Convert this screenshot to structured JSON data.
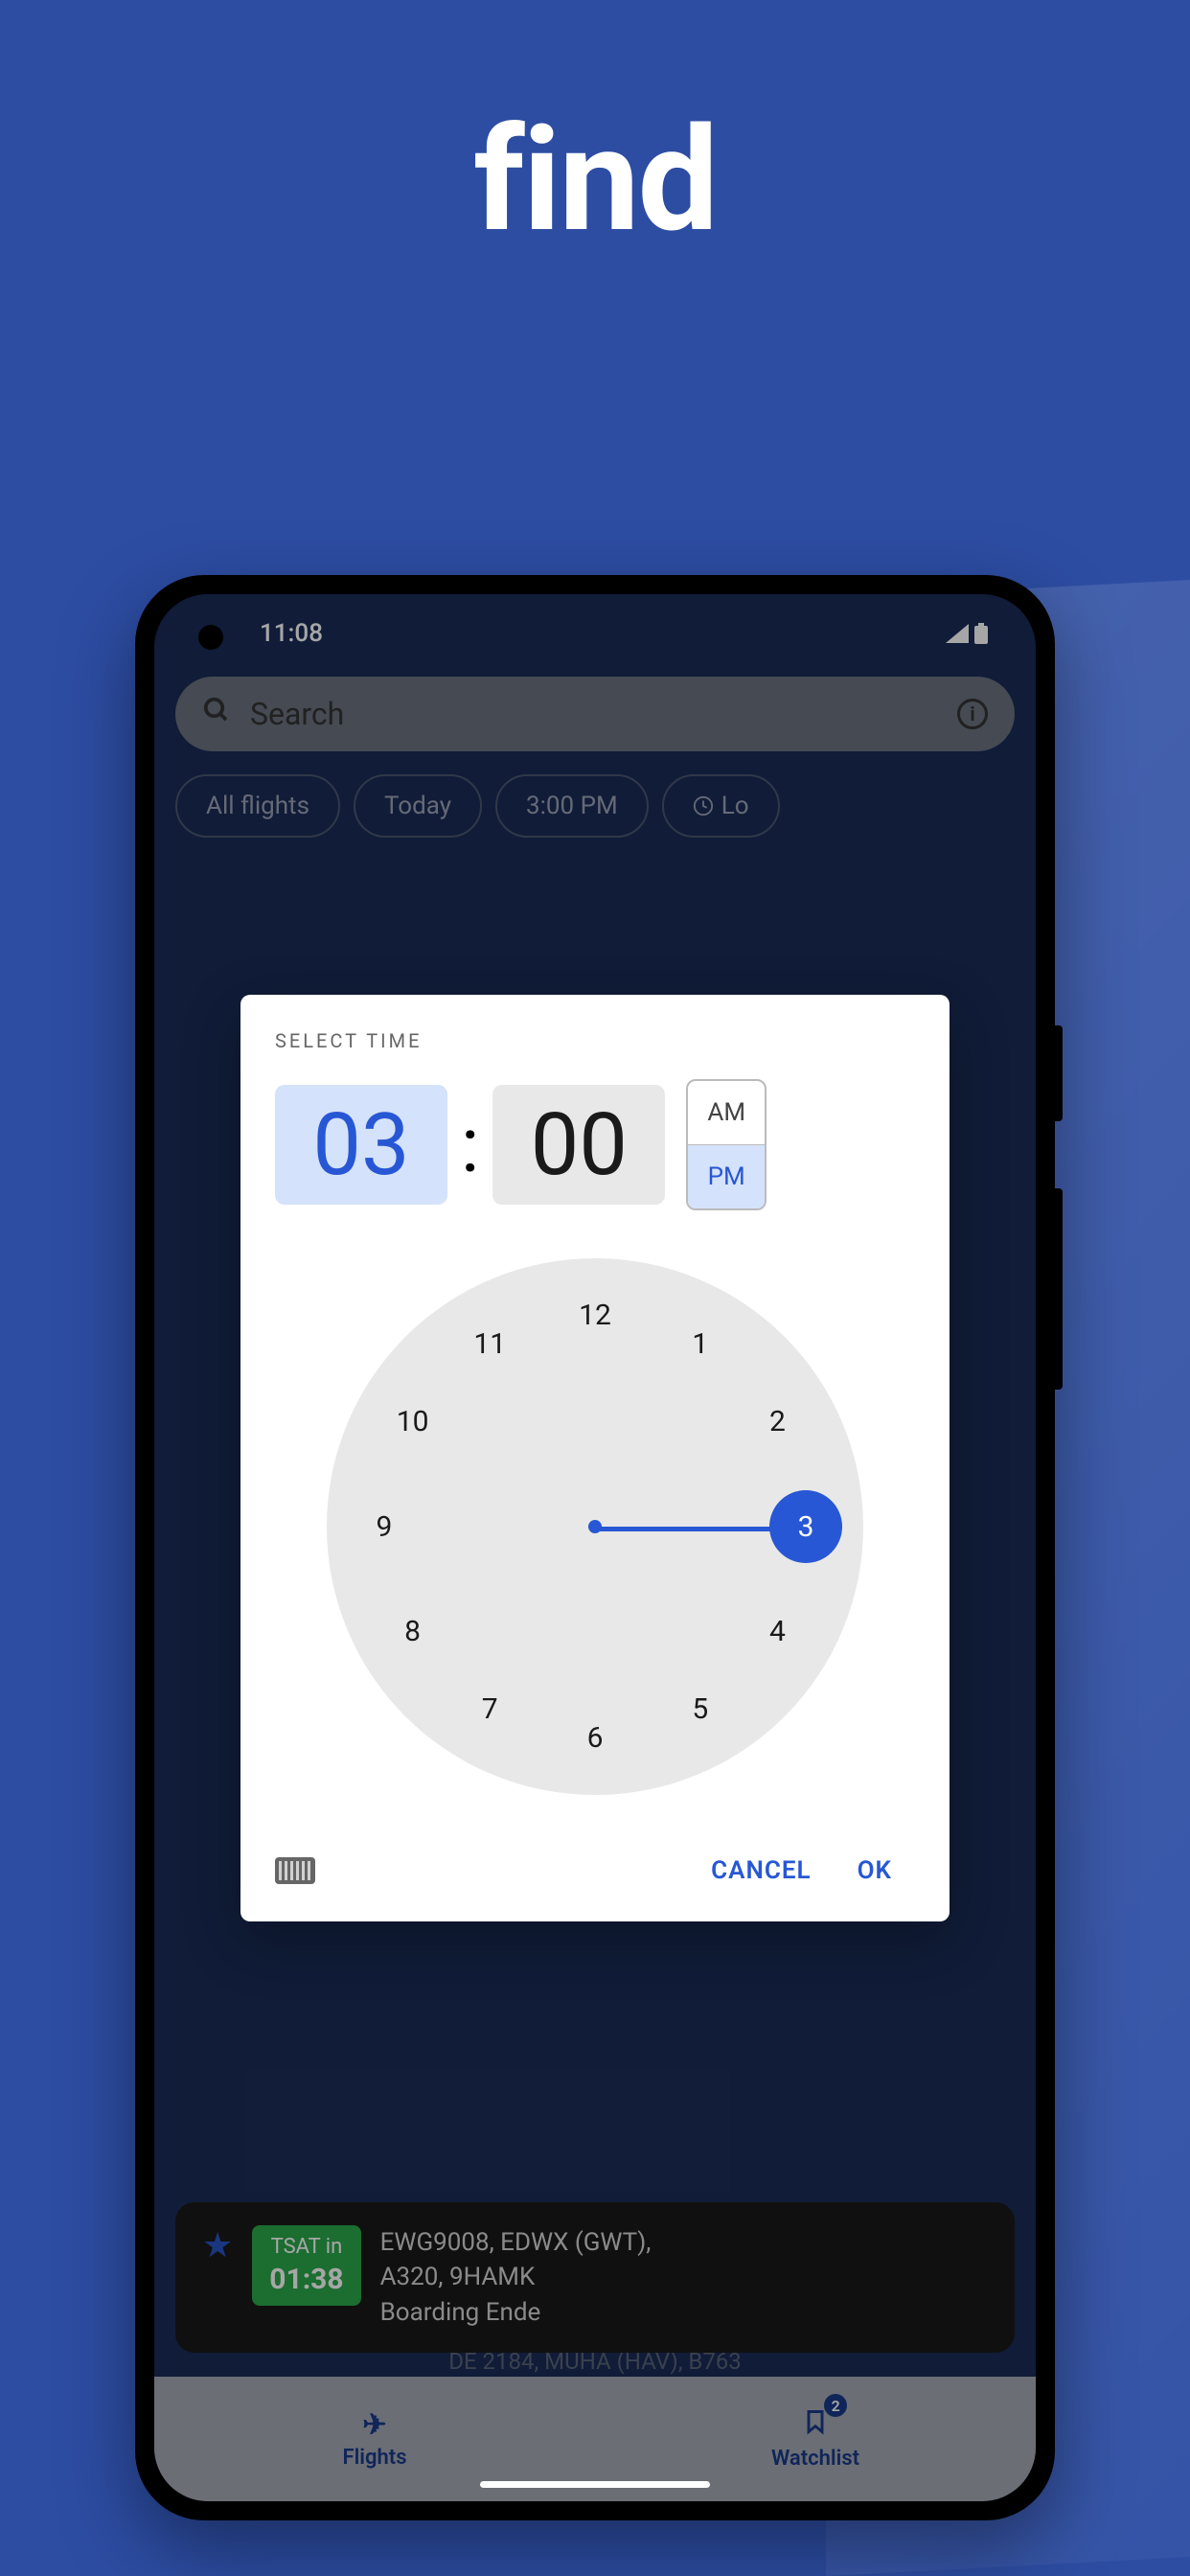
{
  "hero": {
    "title": "find"
  },
  "statusbar": {
    "time": "11:08"
  },
  "search": {
    "placeholder": "Search"
  },
  "chips": [
    {
      "label": "All flights",
      "has_icon": false
    },
    {
      "label": "Today",
      "has_icon": false
    },
    {
      "label": "3:00 PM",
      "has_icon": false
    },
    {
      "label": "Lo",
      "has_icon": true
    }
  ],
  "dialog": {
    "title": "SELECT TIME",
    "hour": "03",
    "minute": "00",
    "am_label": "AM",
    "pm_label": "PM",
    "period_selected": "PM",
    "clock_numbers": [
      "12",
      "1",
      "2",
      "3",
      "4",
      "5",
      "6",
      "7",
      "8",
      "9",
      "10",
      "11"
    ],
    "selected_hour": "3",
    "cancel_label": "CANCEL",
    "ok_label": "OK"
  },
  "flight_card": {
    "tsat_label": "TSAT in",
    "tsat_time": "01:38",
    "line1": "EWG9008, EDWX (GWT),",
    "line2": "A320, 9HAMK",
    "line3": "Boarding Ende"
  },
  "flight_row2": "DE  2184, MUHA (HAV), B763",
  "nav": {
    "flights_label": "Flights",
    "watchlist_label": "Watchlist",
    "watchlist_badge": "2"
  }
}
